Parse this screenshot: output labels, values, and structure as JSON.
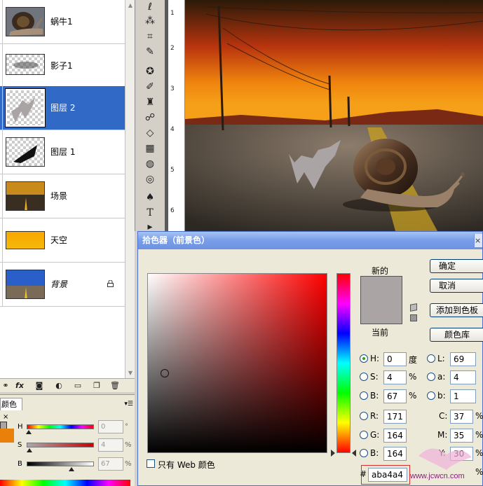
{
  "layers": [
    {
      "name": "蜗牛1",
      "thumb": "snail",
      "selected": false
    },
    {
      "name": "影子1",
      "thumb": "shadow-blur",
      "selected": false
    },
    {
      "name": "图层 2",
      "thumb": "logo-gray",
      "selected": true
    },
    {
      "name": "图层 1",
      "thumb": "shadow-stroke",
      "selected": false
    },
    {
      "name": "场景",
      "thumb": "road",
      "selected": false
    },
    {
      "name": "天空",
      "thumb": "sky-orange",
      "selected": false
    },
    {
      "name": "背景",
      "thumb": "blue-road",
      "selected": false,
      "locked": true
    }
  ],
  "layers_toolbar_icons": [
    "link-icon",
    "fx-icon",
    "mask-icon",
    "adjustment-icon",
    "folder-icon",
    "new-layer-icon",
    "trash-icon"
  ],
  "color_panel": {
    "tab_label": "颜色",
    "close_glyph": "×",
    "foreground_color": "#e8800a",
    "sliders": [
      {
        "label": "H",
        "value": "0",
        "unit": "°",
        "level": 0.03
      },
      {
        "label": "S",
        "value": "4",
        "unit": "%",
        "level": 0.04
      },
      {
        "label": "B",
        "value": "67",
        "unit": "%",
        "level": 0.67
      }
    ]
  },
  "ruler_numbers": [
    "1",
    "2",
    "3",
    "4",
    "5",
    "6"
  ],
  "picker": {
    "title": "拾色器（前景色）",
    "close_glyph": "×",
    "new_label": "新的",
    "current_label": "当前",
    "new_color": "#aba4a4",
    "current_color": "#aba4a4",
    "buttons": {
      "ok": "确定",
      "cancel": "取消",
      "add_swatch": "添加到色板",
      "libraries": "颜色库"
    },
    "hsb": {
      "h": {
        "label": "H:",
        "value": "0",
        "unit": "度"
      },
      "s": {
        "label": "S:",
        "value": "4",
        "unit": "%"
      },
      "b": {
        "label": "B:",
        "value": "67",
        "unit": "%"
      }
    },
    "rgb": {
      "r": {
        "label": "R:",
        "value": "171"
      },
      "g": {
        "label": "G:",
        "value": "164"
      },
      "b": {
        "label": "B:",
        "value": "164"
      }
    },
    "lab": {
      "l": {
        "label": "L:",
        "value": "69"
      },
      "a": {
        "label": "a:",
        "value": "4"
      },
      "b": {
        "label": "b:",
        "value": "1"
      }
    },
    "cmyk": {
      "c": {
        "label": "C:",
        "value": "37",
        "unit": "%"
      },
      "m": {
        "label": "M:",
        "value": "35",
        "unit": "%"
      },
      "y": {
        "label": "Y:",
        "value": "30",
        "unit": "%"
      },
      "k": {
        "label": "K:",
        "value": "",
        "unit": "%"
      }
    },
    "web_only_label": "只有 Web 颜色",
    "hash": "#",
    "hex": "aba4a4"
  },
  "watermark": "www.jcwcn.com"
}
